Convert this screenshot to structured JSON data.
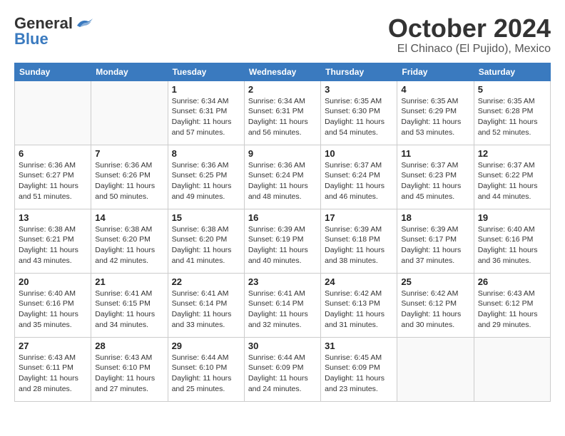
{
  "header": {
    "logo_general": "General",
    "logo_blue": "Blue",
    "month_title": "October 2024",
    "location": "El Chinaco (El Pujido), Mexico"
  },
  "calendar": {
    "days_of_week": [
      "Sunday",
      "Monday",
      "Tuesday",
      "Wednesday",
      "Thursday",
      "Friday",
      "Saturday"
    ],
    "weeks": [
      [
        {
          "day": "",
          "info": ""
        },
        {
          "day": "",
          "info": ""
        },
        {
          "day": "1",
          "info": "Sunrise: 6:34 AM\nSunset: 6:31 PM\nDaylight: 11 hours and 57 minutes."
        },
        {
          "day": "2",
          "info": "Sunrise: 6:34 AM\nSunset: 6:31 PM\nDaylight: 11 hours and 56 minutes."
        },
        {
          "day": "3",
          "info": "Sunrise: 6:35 AM\nSunset: 6:30 PM\nDaylight: 11 hours and 54 minutes."
        },
        {
          "day": "4",
          "info": "Sunrise: 6:35 AM\nSunset: 6:29 PM\nDaylight: 11 hours and 53 minutes."
        },
        {
          "day": "5",
          "info": "Sunrise: 6:35 AM\nSunset: 6:28 PM\nDaylight: 11 hours and 52 minutes."
        }
      ],
      [
        {
          "day": "6",
          "info": "Sunrise: 6:36 AM\nSunset: 6:27 PM\nDaylight: 11 hours and 51 minutes."
        },
        {
          "day": "7",
          "info": "Sunrise: 6:36 AM\nSunset: 6:26 PM\nDaylight: 11 hours and 50 minutes."
        },
        {
          "day": "8",
          "info": "Sunrise: 6:36 AM\nSunset: 6:25 PM\nDaylight: 11 hours and 49 minutes."
        },
        {
          "day": "9",
          "info": "Sunrise: 6:36 AM\nSunset: 6:24 PM\nDaylight: 11 hours and 48 minutes."
        },
        {
          "day": "10",
          "info": "Sunrise: 6:37 AM\nSunset: 6:24 PM\nDaylight: 11 hours and 46 minutes."
        },
        {
          "day": "11",
          "info": "Sunrise: 6:37 AM\nSunset: 6:23 PM\nDaylight: 11 hours and 45 minutes."
        },
        {
          "day": "12",
          "info": "Sunrise: 6:37 AM\nSunset: 6:22 PM\nDaylight: 11 hours and 44 minutes."
        }
      ],
      [
        {
          "day": "13",
          "info": "Sunrise: 6:38 AM\nSunset: 6:21 PM\nDaylight: 11 hours and 43 minutes."
        },
        {
          "day": "14",
          "info": "Sunrise: 6:38 AM\nSunset: 6:20 PM\nDaylight: 11 hours and 42 minutes."
        },
        {
          "day": "15",
          "info": "Sunrise: 6:38 AM\nSunset: 6:20 PM\nDaylight: 11 hours and 41 minutes."
        },
        {
          "day": "16",
          "info": "Sunrise: 6:39 AM\nSunset: 6:19 PM\nDaylight: 11 hours and 40 minutes."
        },
        {
          "day": "17",
          "info": "Sunrise: 6:39 AM\nSunset: 6:18 PM\nDaylight: 11 hours and 38 minutes."
        },
        {
          "day": "18",
          "info": "Sunrise: 6:39 AM\nSunset: 6:17 PM\nDaylight: 11 hours and 37 minutes."
        },
        {
          "day": "19",
          "info": "Sunrise: 6:40 AM\nSunset: 6:16 PM\nDaylight: 11 hours and 36 minutes."
        }
      ],
      [
        {
          "day": "20",
          "info": "Sunrise: 6:40 AM\nSunset: 6:16 PM\nDaylight: 11 hours and 35 minutes."
        },
        {
          "day": "21",
          "info": "Sunrise: 6:41 AM\nSunset: 6:15 PM\nDaylight: 11 hours and 34 minutes."
        },
        {
          "day": "22",
          "info": "Sunrise: 6:41 AM\nSunset: 6:14 PM\nDaylight: 11 hours and 33 minutes."
        },
        {
          "day": "23",
          "info": "Sunrise: 6:41 AM\nSunset: 6:14 PM\nDaylight: 11 hours and 32 minutes."
        },
        {
          "day": "24",
          "info": "Sunrise: 6:42 AM\nSunset: 6:13 PM\nDaylight: 11 hours and 31 minutes."
        },
        {
          "day": "25",
          "info": "Sunrise: 6:42 AM\nSunset: 6:12 PM\nDaylight: 11 hours and 30 minutes."
        },
        {
          "day": "26",
          "info": "Sunrise: 6:43 AM\nSunset: 6:12 PM\nDaylight: 11 hours and 29 minutes."
        }
      ],
      [
        {
          "day": "27",
          "info": "Sunrise: 6:43 AM\nSunset: 6:11 PM\nDaylight: 11 hours and 28 minutes."
        },
        {
          "day": "28",
          "info": "Sunrise: 6:43 AM\nSunset: 6:10 PM\nDaylight: 11 hours and 27 minutes."
        },
        {
          "day": "29",
          "info": "Sunrise: 6:44 AM\nSunset: 6:10 PM\nDaylight: 11 hours and 25 minutes."
        },
        {
          "day": "30",
          "info": "Sunrise: 6:44 AM\nSunset: 6:09 PM\nDaylight: 11 hours and 24 minutes."
        },
        {
          "day": "31",
          "info": "Sunrise: 6:45 AM\nSunset: 6:09 PM\nDaylight: 11 hours and 23 minutes."
        },
        {
          "day": "",
          "info": ""
        },
        {
          "day": "",
          "info": ""
        }
      ]
    ]
  }
}
